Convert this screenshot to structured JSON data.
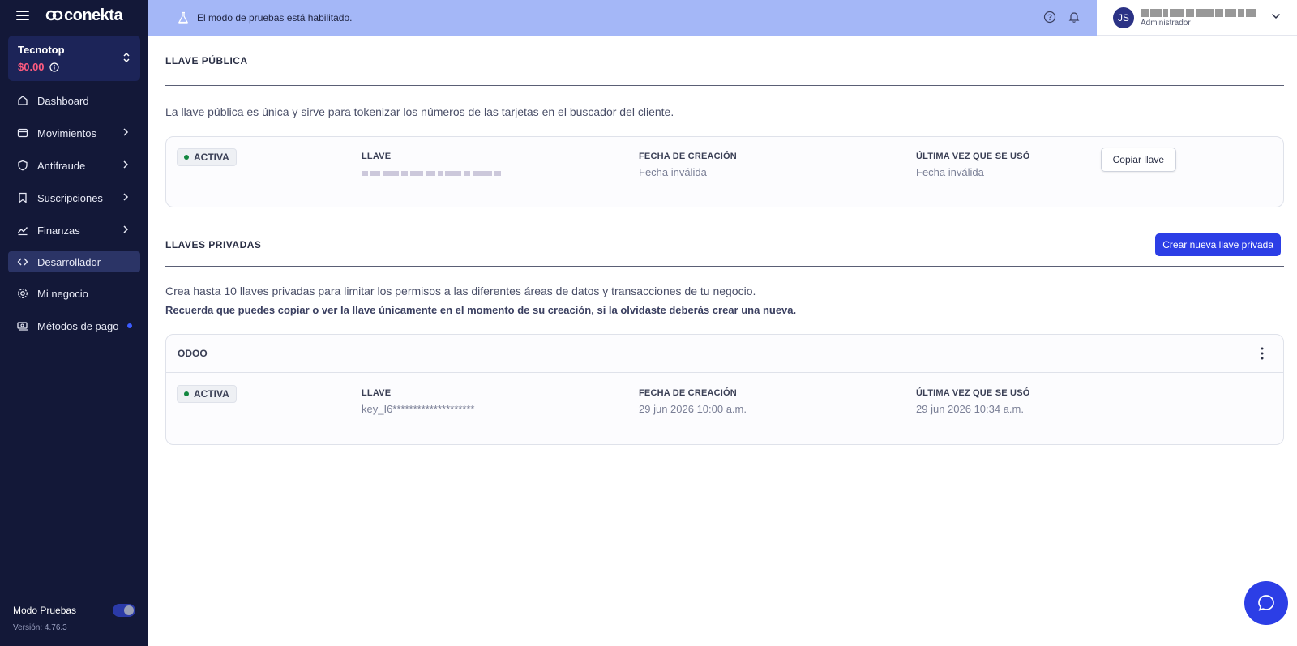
{
  "brand": {
    "logo_text": "conekta"
  },
  "account": {
    "name": "Tecnotop",
    "balance": "$0.00"
  },
  "sidebar": {
    "items": [
      {
        "label": "Dashboard",
        "icon": "home-icon"
      },
      {
        "label": "Movimientos",
        "icon": "wallet-icon"
      },
      {
        "label": "Antifraude",
        "icon": "shield-icon"
      },
      {
        "label": "Suscripciones",
        "icon": "bookmark-icon"
      },
      {
        "label": "Finanzas",
        "icon": "chart-line-icon"
      },
      {
        "label": "Desarrollador",
        "icon": "code-icon"
      },
      {
        "label": "Mi negocio",
        "icon": "gear-icon"
      },
      {
        "label": "Métodos de pago",
        "icon": "payment-icon"
      }
    ],
    "test_mode_label": "Modo Pruebas",
    "version": "Versión: 4.76.3"
  },
  "topbar": {
    "test_mode_text": "El modo de pruebas está habilitado."
  },
  "user": {
    "initials": "JS",
    "role": "Administrador"
  },
  "public_key": {
    "section_title": "LLAVE PÚBLICA",
    "description": "La llave pública es única y sirve para tokenizar los números de las tarjetas en el buscador del cliente.",
    "status": "ACTIVA",
    "key_label": "LLAVE",
    "created_label": "FECHA DE CREACIÓN",
    "created_value": "Fecha inválida",
    "last_used_label": "ÚLTIMA VEZ QUE SE USÓ",
    "last_used_value": "Fecha inválida",
    "copy_button": "Copiar llave"
  },
  "private_keys": {
    "section_title": "LLAVES PRIVADAS",
    "create_button": "Crear nueva llave privada",
    "description": "Crea hasta 10 llaves privadas para limitar los permisos a las diferentes áreas de datos y transacciones de tu negocio.",
    "warning": "Recuerda que puedes copiar o ver la llave únicamente en el momento de su creación, si la olvidaste deberás crear una nueva.",
    "keys": [
      {
        "name": "ODOO",
        "status": "ACTIVA",
        "key_label": "LLAVE",
        "key_value": "key_I6********************",
        "created_label": "FECHA DE CREACIÓN",
        "created_value": "29 jun 2026 10:00 a.m.",
        "last_used_label": "ÚLTIMA VEZ QUE SE USÓ",
        "last_used_value": "29 jun 2026 10:34 a.m."
      }
    ]
  }
}
